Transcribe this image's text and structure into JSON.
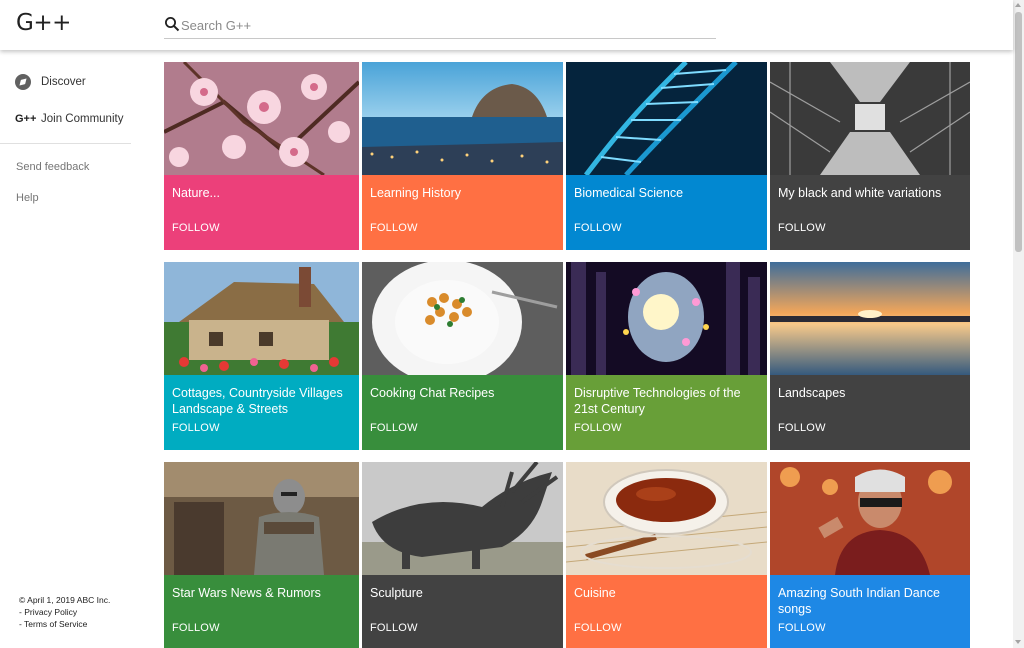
{
  "app": {
    "logo": "G++"
  },
  "search": {
    "placeholder": "Search G++"
  },
  "sidebar": {
    "discover_label": "Discover",
    "join_icon_text": "G++",
    "join_label": "Join Community",
    "send_feedback": "Send feedback",
    "help": "Help"
  },
  "footer": {
    "copyright": "© April 1, 2019 ABC Inc.",
    "privacy": "- Privacy Policy",
    "terms": "- Terms of Service"
  },
  "cards": [
    {
      "title": "Nature...",
      "follow": "FOLLOW",
      "color": "#ec407a",
      "image": "cherry-blossom"
    },
    {
      "title": "Learning History",
      "follow": "FOLLOW",
      "color": "#ff7043",
      "image": "coastal-town"
    },
    {
      "title": "Biomedical Science",
      "follow": "FOLLOW",
      "color": "#0288d1",
      "image": "dna-helix"
    },
    {
      "title": "My black and white variations",
      "follow": "FOLLOW",
      "color": "#424242",
      "image": "eiffel-tower"
    },
    {
      "title": "Cottages, Countryside Villages Landscape & Streets",
      "follow": "FOLLOW",
      "color": "#00acc1",
      "image": "thatched-cottage"
    },
    {
      "title": "Cooking Chat Recipes",
      "follow": "FOLLOW",
      "color": "#388e3c",
      "image": "chickpea-dish"
    },
    {
      "title": "Disruptive Technologies of the 21st Century",
      "follow": "FOLLOW",
      "color": "#689f38",
      "image": "tech-head"
    },
    {
      "title": "Landscapes",
      "follow": "FOLLOW",
      "color": "#424242",
      "image": "sunset-lake"
    },
    {
      "title": "Star Wars News & Rumors",
      "follow": "FOLLOW",
      "color": "#388e3c",
      "image": "armored-warrior"
    },
    {
      "title": "Sculpture",
      "follow": "FOLLOW",
      "color": "#424242",
      "image": "horned-sculpture"
    },
    {
      "title": "Cuisine",
      "follow": "FOLLOW",
      "color": "#ff7043",
      "image": "tea-cup"
    },
    {
      "title": "Amazing South Indian Dance songs",
      "follow": "FOLLOW",
      "color": "#1e88e5",
      "image": "man-sunglasses"
    }
  ]
}
